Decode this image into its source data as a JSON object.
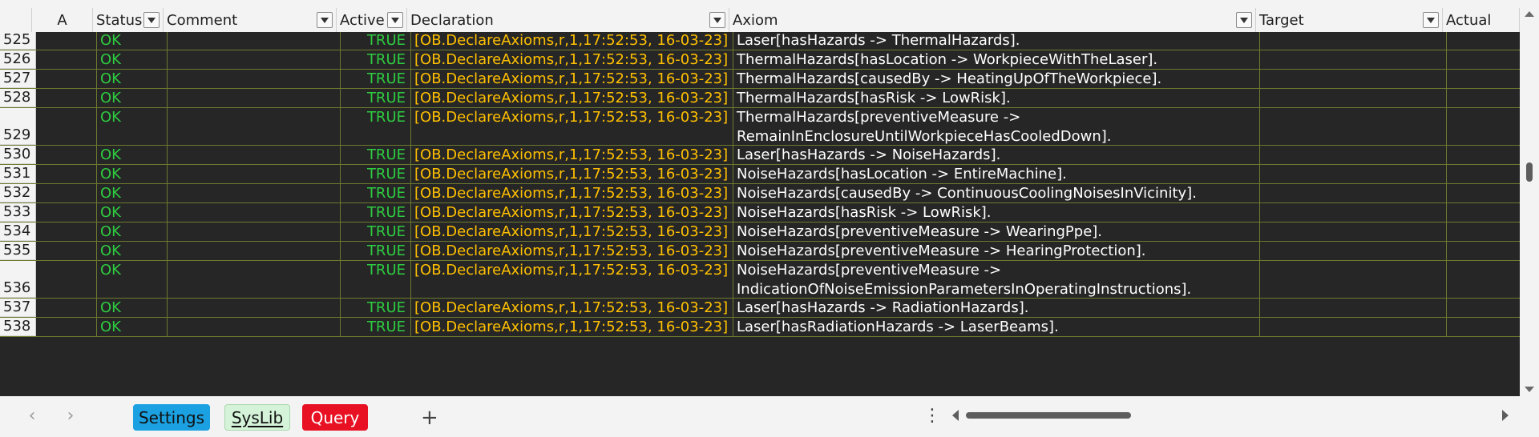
{
  "columns": {
    "a": "A",
    "status": "Status",
    "comment": "Comment",
    "active": "Active",
    "declaration": "Declaration",
    "axiom": "Axiom",
    "target": "Target",
    "actual": "Actual"
  },
  "rows": [
    {
      "num": "525",
      "status": "OK",
      "active": "TRUE",
      "declaration": "[OB.DeclareAxioms,r,1,17:52:53, 16-03-23]",
      "axiom": [
        "Laser[hasHazards -> ThermalHazards]."
      ]
    },
    {
      "num": "526",
      "status": "OK",
      "active": "TRUE",
      "declaration": "[OB.DeclareAxioms,r,1,17:52:53, 16-03-23]",
      "axiom": [
        "ThermalHazards[hasLocation -> WorkpieceWithTheLaser]."
      ]
    },
    {
      "num": "527",
      "status": "OK",
      "active": "TRUE",
      "declaration": "[OB.DeclareAxioms,r,1,17:52:53, 16-03-23]",
      "axiom": [
        "ThermalHazards[causedBy -> HeatingUpOfTheWorkpiece]."
      ]
    },
    {
      "num": "528",
      "status": "OK",
      "active": "TRUE",
      "declaration": "[OB.DeclareAxioms,r,1,17:52:53, 16-03-23]",
      "axiom": [
        "ThermalHazards[hasRisk -> LowRisk]."
      ]
    },
    {
      "num": "529",
      "status": "OK",
      "active": "TRUE",
      "declaration": "[OB.DeclareAxioms,r,1,17:52:53, 16-03-23]",
      "axiom": [
        "ThermalHazards[preventiveMeasure ->",
        "RemainInEnclosureUntilWorkpieceHasCooledDown]."
      ]
    },
    {
      "num": "530",
      "status": "OK",
      "active": "TRUE",
      "declaration": "[OB.DeclareAxioms,r,1,17:52:53, 16-03-23]",
      "axiom": [
        "Laser[hasHazards -> NoiseHazards]."
      ]
    },
    {
      "num": "531",
      "status": "OK",
      "active": "TRUE",
      "declaration": "[OB.DeclareAxioms,r,1,17:52:53, 16-03-23]",
      "axiom": [
        "NoiseHazards[hasLocation -> EntireMachine]."
      ]
    },
    {
      "num": "532",
      "status": "OK",
      "active": "TRUE",
      "declaration": "[OB.DeclareAxioms,r,1,17:52:53, 16-03-23]",
      "axiom": [
        "NoiseHazards[causedBy -> ContinuousCoolingNoisesInVicinity]."
      ]
    },
    {
      "num": "533",
      "status": "OK",
      "active": "TRUE",
      "declaration": "[OB.DeclareAxioms,r,1,17:52:53, 16-03-23]",
      "axiom": [
        "NoiseHazards[hasRisk -> LowRisk]."
      ]
    },
    {
      "num": "534",
      "status": "OK",
      "active": "TRUE",
      "declaration": "[OB.DeclareAxioms,r,1,17:52:53, 16-03-23]",
      "axiom": [
        "NoiseHazards[preventiveMeasure -> WearingPpe]."
      ]
    },
    {
      "num": "535",
      "status": "OK",
      "active": "TRUE",
      "declaration": "[OB.DeclareAxioms,r,1,17:52:53, 16-03-23]",
      "axiom": [
        "NoiseHazards[preventiveMeasure -> HearingProtection]."
      ]
    },
    {
      "num": "536",
      "status": "OK",
      "active": "TRUE",
      "declaration": "[OB.DeclareAxioms,r,1,17:52:53, 16-03-23]",
      "axiom": [
        "NoiseHazards[preventiveMeasure ->",
        "IndicationOfNoiseEmissionParametersInOperatingInstructions]."
      ]
    },
    {
      "num": "537",
      "status": "OK",
      "active": "TRUE",
      "declaration": "[OB.DeclareAxioms,r,1,17:52:53, 16-03-23]",
      "axiom": [
        "Laser[hasHazards -> RadiationHazards]."
      ]
    },
    {
      "num": "538",
      "status": "OK",
      "active": "TRUE",
      "declaration": "[OB.DeclareAxioms,r,1,17:52:53, 16-03-23]",
      "axiom": [
        "Laser[hasRadiationHazards -> LaserBeams]."
      ]
    }
  ],
  "tabs": {
    "settings": "Settings",
    "syslib": "SysLib",
    "query": "Query",
    "active": "SysLib"
  },
  "icons": {
    "prev": "chevron-left-icon",
    "next": "chevron-right-icon",
    "add": "plus-icon",
    "more": "more-vertical-icon",
    "filter": "dropdown-filter-icon"
  },
  "glyphs": {
    "prev": "‹",
    "next": "›",
    "add": "+",
    "more": "⋮"
  },
  "colors": {
    "status_ok": "#2ecc40",
    "declaration": "#ffc000",
    "grid_line": "#6d7a2e",
    "settings_tab": "#1ba1e2",
    "syslib_tab": "#d4f3d9",
    "query_tab": "#e81123"
  }
}
